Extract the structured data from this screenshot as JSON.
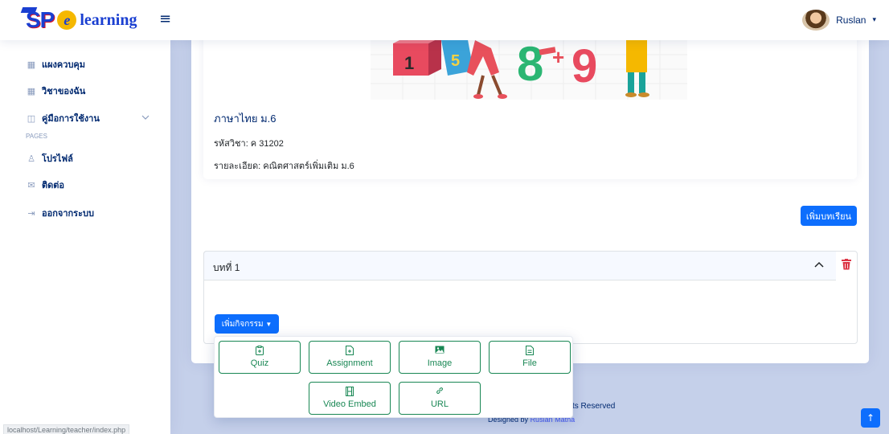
{
  "header": {
    "logo_sp": "SP",
    "logo_text": "learning",
    "user_name": "Ruslan"
  },
  "sidebar": {
    "items": [
      {
        "label": "แผงควบคุม",
        "icon": "grid-icon"
      },
      {
        "label": "วิชาของฉัน",
        "icon": "grid-icon"
      },
      {
        "label": "คู่มือการใช้งาน",
        "icon": "book-icon"
      }
    ],
    "pages_heading": "PAGES",
    "page_items": [
      {
        "label": "โปรไฟล์",
        "icon": "person-icon"
      },
      {
        "label": "ติดต่อ",
        "icon": "envelope-icon"
      },
      {
        "label": "ออกจากระบบ",
        "icon": "logout-icon"
      }
    ]
  },
  "course": {
    "title": "ภาษาไทย ม.6",
    "code": "รหัสวิชา: ค 31202",
    "description": "รายละเอียด: คณิตศาสตร์เพิ่มเติม ม.6"
  },
  "actions": {
    "add_lesson": "เพิ่มบทเรียน",
    "add_activity": "เพิ่มกิจกรรม"
  },
  "lesson": {
    "title": "บทที่ 1"
  },
  "activity_options": [
    {
      "label": "Quiz",
      "icon": "clipboard-icon"
    },
    {
      "label": "Assignment",
      "icon": "file-plus-icon"
    },
    {
      "label": "Image",
      "icon": "image-icon"
    },
    {
      "label": "File",
      "icon": "file-text-icon"
    },
    {
      "label": "Video Embed",
      "icon": "film-icon"
    },
    {
      "label": "URL",
      "icon": "link-icon"
    }
  ],
  "footer": {
    "copyright_tail": "ts Reserved",
    "designed_by": "Designed by",
    "designer": "Ruslan Matha"
  },
  "status_bar": {
    "url": "localhost/Learning/teacher/index.php"
  },
  "colors": {
    "primary": "#0d6efd",
    "navy": "#012970",
    "success": "#198754",
    "danger": "#dc3545"
  }
}
